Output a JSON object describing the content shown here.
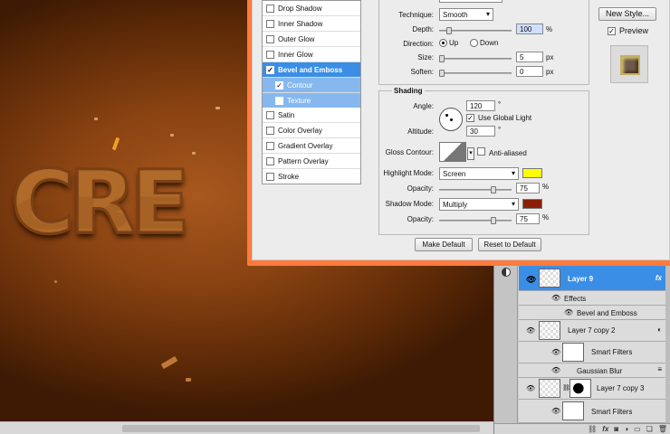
{
  "dialog": {
    "styles": [
      {
        "label": "Drop Shadow",
        "checked": false
      },
      {
        "label": "Inner Shadow",
        "checked": false
      },
      {
        "label": "Outer Glow",
        "checked": false
      },
      {
        "label": "Inner Glow",
        "checked": false
      },
      {
        "label": "Bevel and Emboss",
        "checked": true,
        "selected": true
      },
      {
        "label": "Contour",
        "checked": true,
        "sub": true
      },
      {
        "label": "Texture",
        "checked": false,
        "sub": true
      },
      {
        "label": "Satin",
        "checked": false
      },
      {
        "label": "Color Overlay",
        "checked": false
      },
      {
        "label": "Gradient Overlay",
        "checked": false
      },
      {
        "label": "Pattern Overlay",
        "checked": false
      },
      {
        "label": "Stroke",
        "checked": false
      }
    ],
    "structure": {
      "technique_label": "Technique:",
      "technique_value": "Smooth",
      "depth_label": "Depth:",
      "depth_value": "100",
      "percent": "%",
      "direction_label": "Direction:",
      "dir_up": "Up",
      "dir_down": "Down",
      "size_label": "Size:",
      "size_value": "5",
      "px": "px",
      "soften_label": "Soften:",
      "soften_value": "0"
    },
    "shading": {
      "title": "Shading",
      "angle_label": "Angle:",
      "angle_value": "120",
      "degree": "°",
      "global_light": "Use Global Light",
      "altitude_label": "Altitude:",
      "altitude_value": "30",
      "gloss_label": "Gloss Contour:",
      "anti_aliased": "Anti-aliased",
      "highlight_mode_label": "Highlight Mode:",
      "highlight_mode": "Screen",
      "highlight_color": "#ffff00",
      "opacity_label": "Opacity:",
      "highlight_opacity": "75",
      "shadow_mode_label": "Shadow Mode:",
      "shadow_mode": "Multiply",
      "shadow_color": "#8a1f06",
      "shadow_opacity": "75"
    },
    "make_default": "Make Default",
    "reset_default": "Reset to Default",
    "new_style": "New Style...",
    "preview": "Preview",
    "accent": "#ff7a3c"
  },
  "canvas": {
    "art_text": "CRE"
  },
  "layers": [
    {
      "name": "Layer 9",
      "type": "layer",
      "selected": true,
      "fx": "fx"
    },
    {
      "name": "Effects",
      "type": "effects"
    },
    {
      "name": "Bevel and Emboss",
      "type": "effect"
    },
    {
      "name": "Layer 7 copy 2",
      "type": "smart"
    },
    {
      "name": "Smart Filters",
      "type": "filters"
    },
    {
      "name": "Gaussian Blur",
      "type": "effect"
    },
    {
      "name": "Layer 7 copy 3",
      "type": "smartmask"
    },
    {
      "name": "Smart Filters",
      "type": "filters"
    }
  ]
}
